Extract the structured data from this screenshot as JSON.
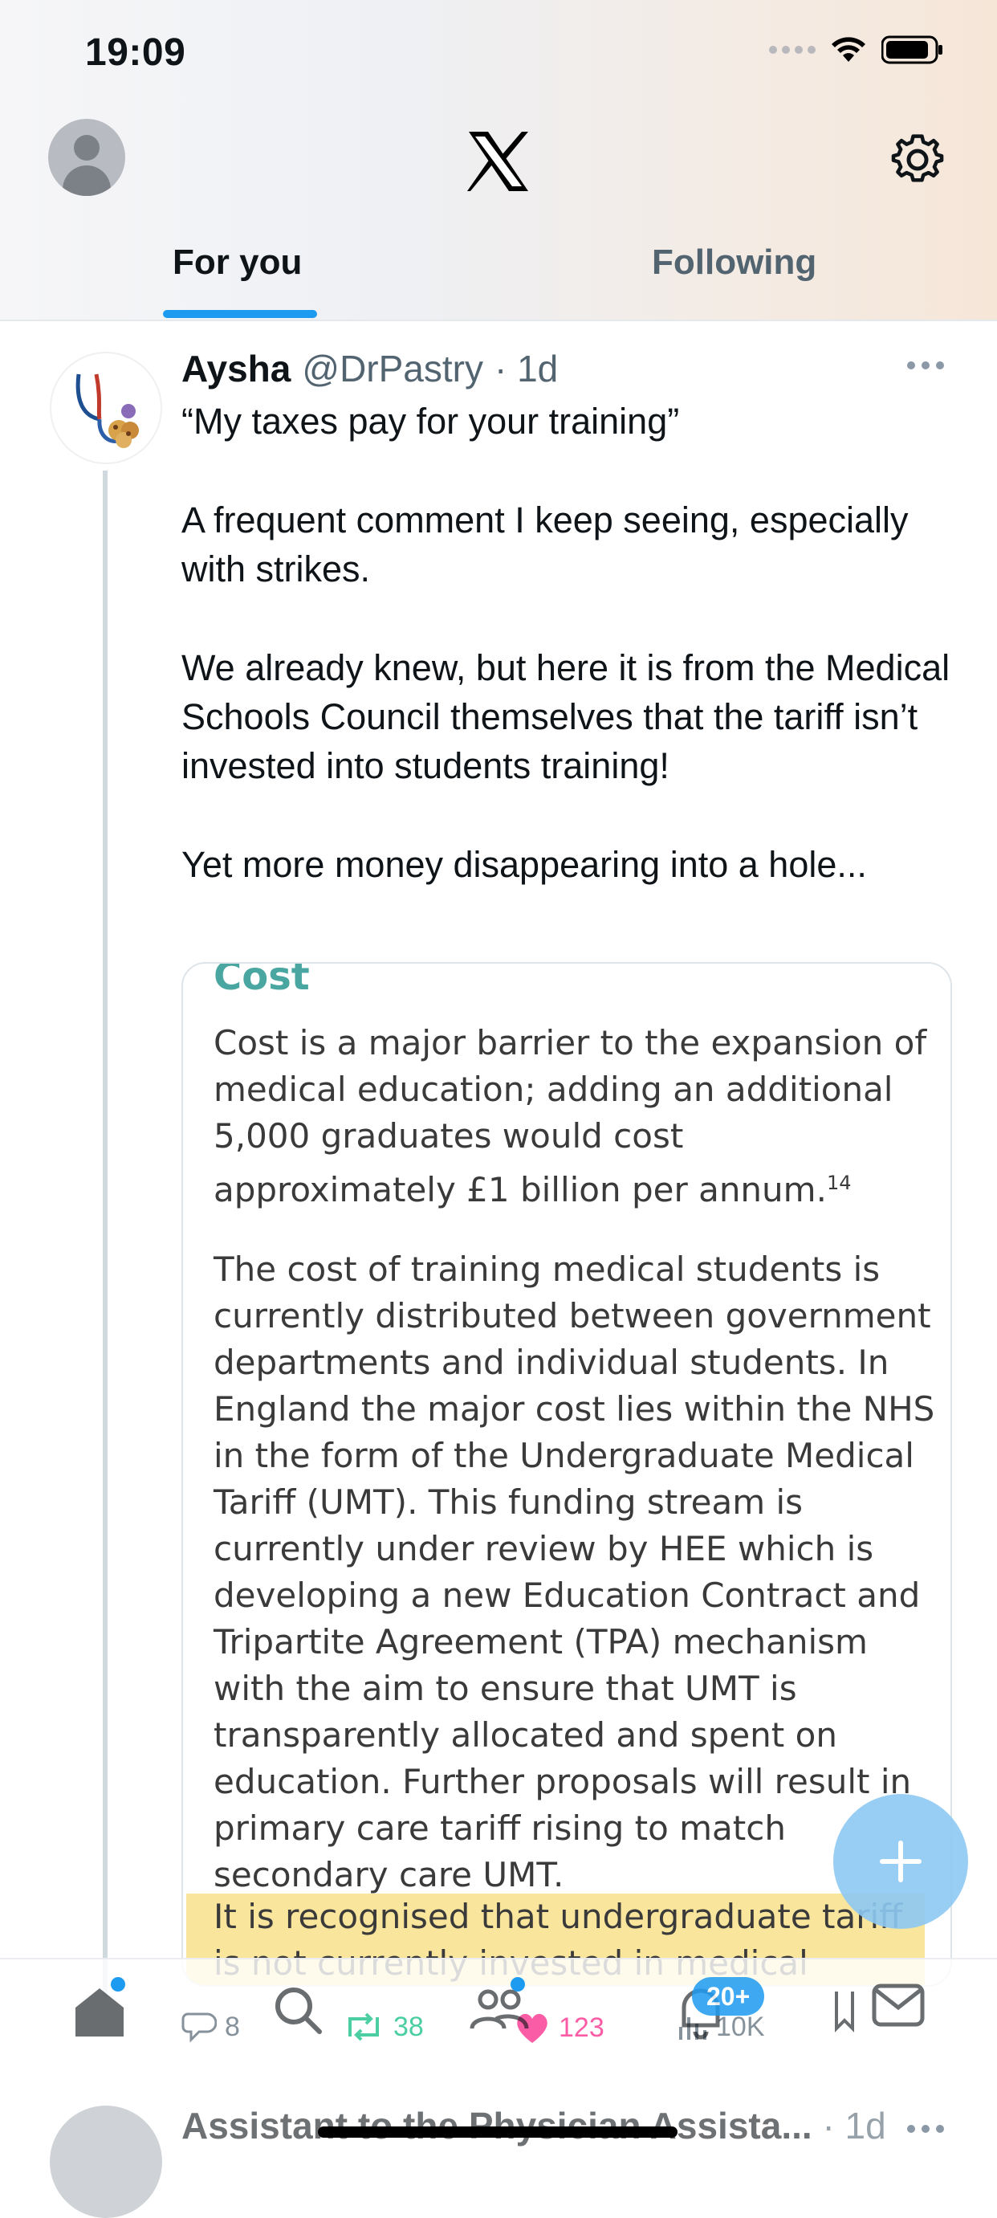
{
  "status_bar": {
    "time": "19:09"
  },
  "header": {
    "tabs": [
      {
        "label": "For you",
        "active": true
      },
      {
        "label": "Following",
        "active": false
      }
    ]
  },
  "tweet": {
    "name": "Aysha",
    "handle": "@DrPastry",
    "time": "· 1d",
    "text_paragraphs": [
      "“My taxes pay for your training”",
      "A frequent comment I keep seeing, especially with strikes.",
      "We already knew, but here it is from the Medical Schools Council themselves that the tariff isn’t invested into students training!",
      "Yet more money disappearing into a hole..."
    ],
    "image": {
      "heading": "Cost",
      "para1": "Cost is a major barrier to the expansion of medical education; adding an additional 5,000 graduates would cost approximately £1 billion per annum.",
      "para1_sup": "14",
      "para2": "The cost of training medical students is currently distributed between government departments and individual students. In England the major cost lies within the NHS in the form of the Undergraduate Medical Tariff (UMT). This funding stream is currently under review by HEE which is developing a new Education Contract and Tripartite Agreement (TPA) mechanism with the aim to ensure that UMT is transparently allocated and spent on education. Further proposals will result in primary care tariff rising to match secondary care UMT.",
      "para3": "It is recognised that undergraduate tariff is not currently invested in medical education."
    },
    "actions": {
      "replies": "8",
      "retweets": "38",
      "likes": "123",
      "views": "10K"
    }
  },
  "bottom_nav": {
    "notifications_badge": "20+",
    "icons": [
      "home-icon",
      "search-icon",
      "communities-icon",
      "notifications-icon",
      "messages-icon"
    ]
  },
  "next_tweet": {
    "name": "Assistant to the Physician Assista...",
    "time": "· 1d"
  },
  "colors": {
    "accent": "#1d9bf0",
    "retweet": "#00ba7c",
    "like": "#f91880",
    "highlight": "#f8e08a"
  }
}
